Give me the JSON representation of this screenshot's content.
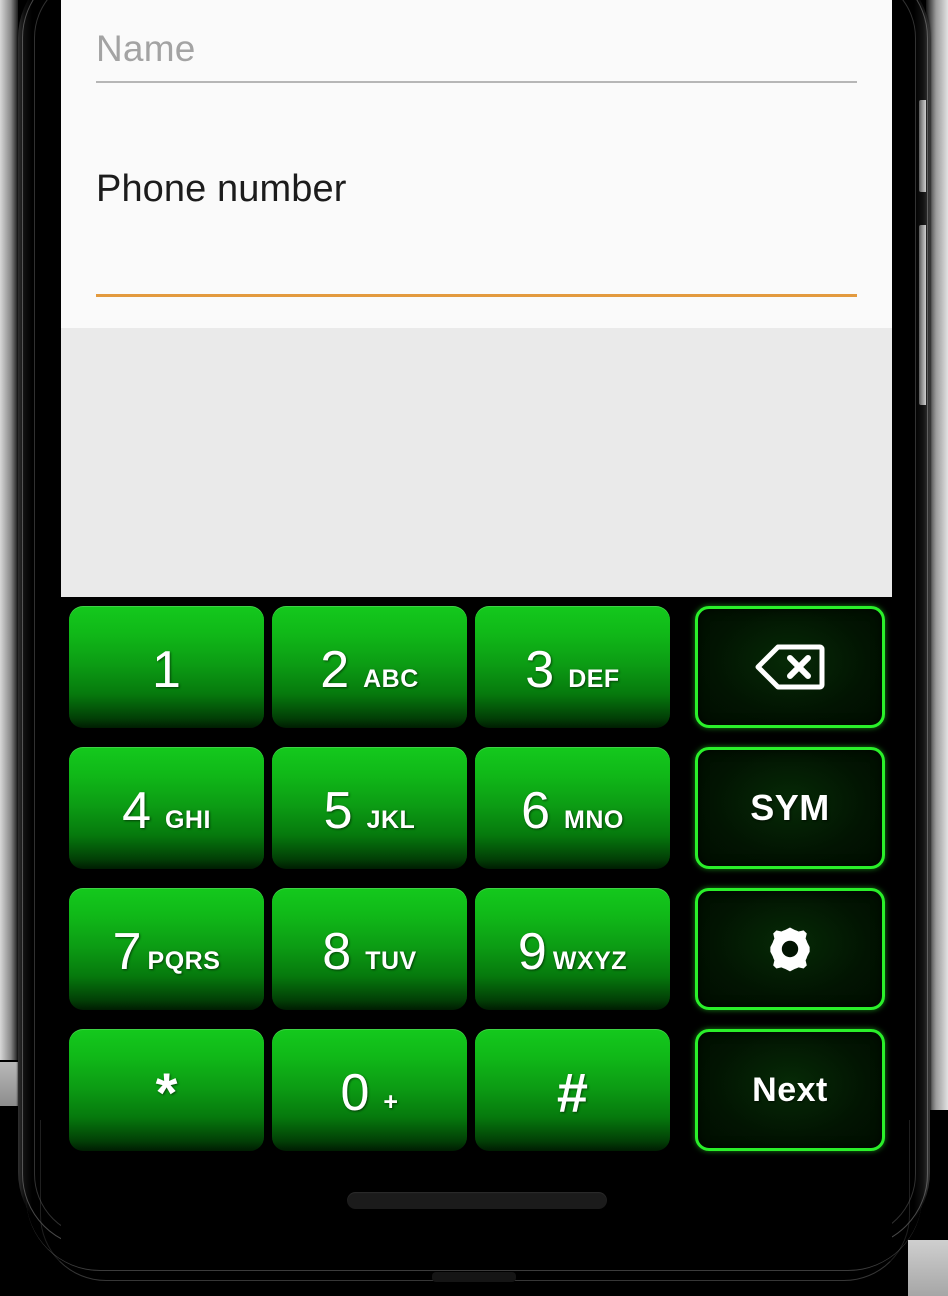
{
  "device": {
    "name": "smartphone-mockup",
    "frame_color": "#000000",
    "side_buttons": [
      "volume-rocker",
      "power-button",
      "mute-switch"
    ],
    "home_indicator": true
  },
  "screen": {
    "background": "#fafafa",
    "filler_background": "#eaeaea"
  },
  "form": {
    "name_field": {
      "placeholder": "Name",
      "value": "",
      "underline_color": "#b6b6b6"
    },
    "phone_field": {
      "label": "Phone number",
      "value": "",
      "focused": true,
      "underline_color": "#e39a3e"
    }
  },
  "keyboard": {
    "type": "numeric-phone-keypad",
    "theme": {
      "background": "#000000",
      "digit_key_top": "#14c91d",
      "digit_key_bottom": "#001c02",
      "function_key_border": "#2af02a",
      "function_key_fill": "#021402",
      "label_color": "#ffffff"
    },
    "rows": [
      {
        "keys": [
          {
            "name": "key-1",
            "digit": "1",
            "letters": ""
          },
          {
            "name": "key-2",
            "digit": "2",
            "letters": "ABC"
          },
          {
            "name": "key-3",
            "digit": "3",
            "letters": "DEF"
          },
          {
            "name": "key-backspace",
            "icon": "backspace-icon",
            "label": ""
          }
        ]
      },
      {
        "keys": [
          {
            "name": "key-4",
            "digit": "4",
            "letters": "GHI"
          },
          {
            "name": "key-5",
            "digit": "5",
            "letters": "JKL"
          },
          {
            "name": "key-6",
            "digit": "6",
            "letters": "MNO"
          },
          {
            "name": "key-sym",
            "icon": "",
            "label": "SYM"
          }
        ]
      },
      {
        "keys": [
          {
            "name": "key-7",
            "digit": "7",
            "letters": "PQRS"
          },
          {
            "name": "key-8",
            "digit": "8",
            "letters": "TUV"
          },
          {
            "name": "key-9",
            "digit": "9",
            "letters": "WXYZ"
          },
          {
            "name": "key-settings",
            "icon": "gear-icon",
            "label": ""
          }
        ]
      },
      {
        "keys": [
          {
            "name": "key-asterisk",
            "digit": "*",
            "letters": ""
          },
          {
            "name": "key-0",
            "digit": "0",
            "letters": "+"
          },
          {
            "name": "key-hash",
            "digit": "#",
            "letters": ""
          },
          {
            "name": "key-next",
            "icon": "",
            "label": "Next"
          }
        ]
      }
    ]
  }
}
